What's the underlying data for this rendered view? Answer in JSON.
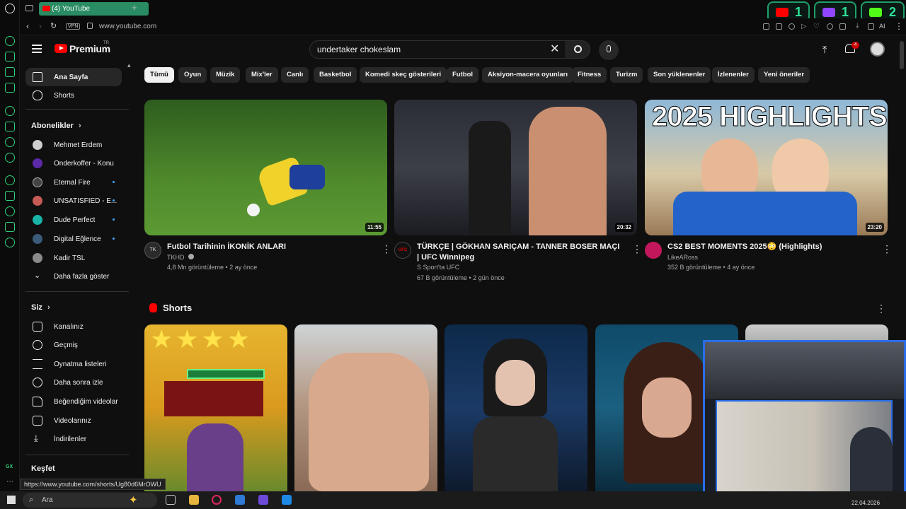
{
  "browser": {
    "tab_title": "(4) YouTube",
    "vpn": "VPN",
    "url": "www.youtube.com",
    "ai": "AI",
    "sidebar_gx": "GX"
  },
  "stream_badges": [
    {
      "platform": "youtube",
      "count": "1",
      "color": "#ff0000"
    },
    {
      "platform": "twitch",
      "count": "1",
      "color": "#9146ff"
    },
    {
      "platform": "kick",
      "count": "2",
      "color": "#53fc18"
    }
  ],
  "header": {
    "logo_text": "Premium",
    "logo_sup": "TR",
    "search_value": "undertaker chokeslam",
    "notification_count": "4"
  },
  "sidebar": {
    "main": [
      {
        "label": "Ana Sayfa",
        "icon": "home-icon"
      },
      {
        "label": "Shorts",
        "icon": "shorts-icon"
      }
    ],
    "subscriptions_title": "Abonelikler",
    "subscriptions": [
      {
        "label": "Mehmet Erdem",
        "color": "#cfcfcf",
        "dot": false
      },
      {
        "label": "Onderkoffer - Konu",
        "color": "#5b2aa8",
        "dot": false
      },
      {
        "label": "Eternal Fire",
        "color": "#444444",
        "dot": true
      },
      {
        "label": "UNSATISFIED - E...",
        "color": "#c65b55",
        "dot": true
      },
      {
        "label": "Dude Perfect",
        "color": "#19b3a8",
        "dot": true
      },
      {
        "label": "Digital Eğlence",
        "color": "#3a5c7a",
        "dot": true
      },
      {
        "label": "Kadir TSL",
        "color": "#8a8a8a",
        "dot": false
      }
    ],
    "show_more": "Daha fazla göster",
    "you_title": "Siz",
    "you": [
      {
        "label": "Kanalınız",
        "icon": "channel-icon"
      },
      {
        "label": "Geçmiş",
        "icon": "history-icon"
      },
      {
        "label": "Oynatma listeleri",
        "icon": "playlist-icon"
      },
      {
        "label": "Daha sonra izle",
        "icon": "watch-later-icon"
      },
      {
        "label": "Beğendiğim videolar",
        "icon": "like-icon"
      },
      {
        "label": "Videolarınız",
        "icon": "your-videos-icon"
      },
      {
        "label": "İndirilenler",
        "icon": "download-icon"
      }
    ],
    "explore_title": "Keşfet"
  },
  "chips": [
    "Tümü",
    "Oyun",
    "Müzik",
    "Mix'ler",
    "Canlı",
    "Basketbol",
    "Komedi skeç gösterileri",
    "Futbol",
    "Aksiyon-macera oyunları",
    "Fitness",
    "Turizm",
    "Son yüklenenler",
    "İzlenenler",
    "Yeni öneriler"
  ],
  "videos": [
    {
      "title": "Futbol Tarihinin İKONİK ANLARI",
      "channel": "TKHD",
      "verified": true,
      "meta": "4,8 Mn görüntüleme • 2 ay önce",
      "duration": "11:55",
      "avatar_text": "TK",
      "avatar_color": "#2a2a2a"
    },
    {
      "title": "TÜRKÇE | GÖKHAN SARIÇAM - TANNER BOSER MAÇI | UFC Winnipeg",
      "channel": "S Sport'ta UFC",
      "verified": false,
      "meta": "67 B görüntüleme • 2 gün önce",
      "duration": "20:32",
      "avatar_text": "UFC",
      "avatar_color": "#111111"
    },
    {
      "title": "CS2 BEST MOMENTS 2025😳 (Highlights)",
      "channel": "LikeARoss",
      "verified": false,
      "meta": "352 B görüntüleme • 4 ay önce",
      "duration": "23:20",
      "avatar_text": "",
      "avatar_color": "#c2185b"
    }
  ],
  "thumb3_text": "2025 HIGHLIGHTS",
  "shorts_title": "Shorts",
  "status_url": "https://www.youtube.com/shorts/Ug80d6MrOWU",
  "taskbar": {
    "search_placeholder": "Ara",
    "date": "22.04.2026"
  }
}
